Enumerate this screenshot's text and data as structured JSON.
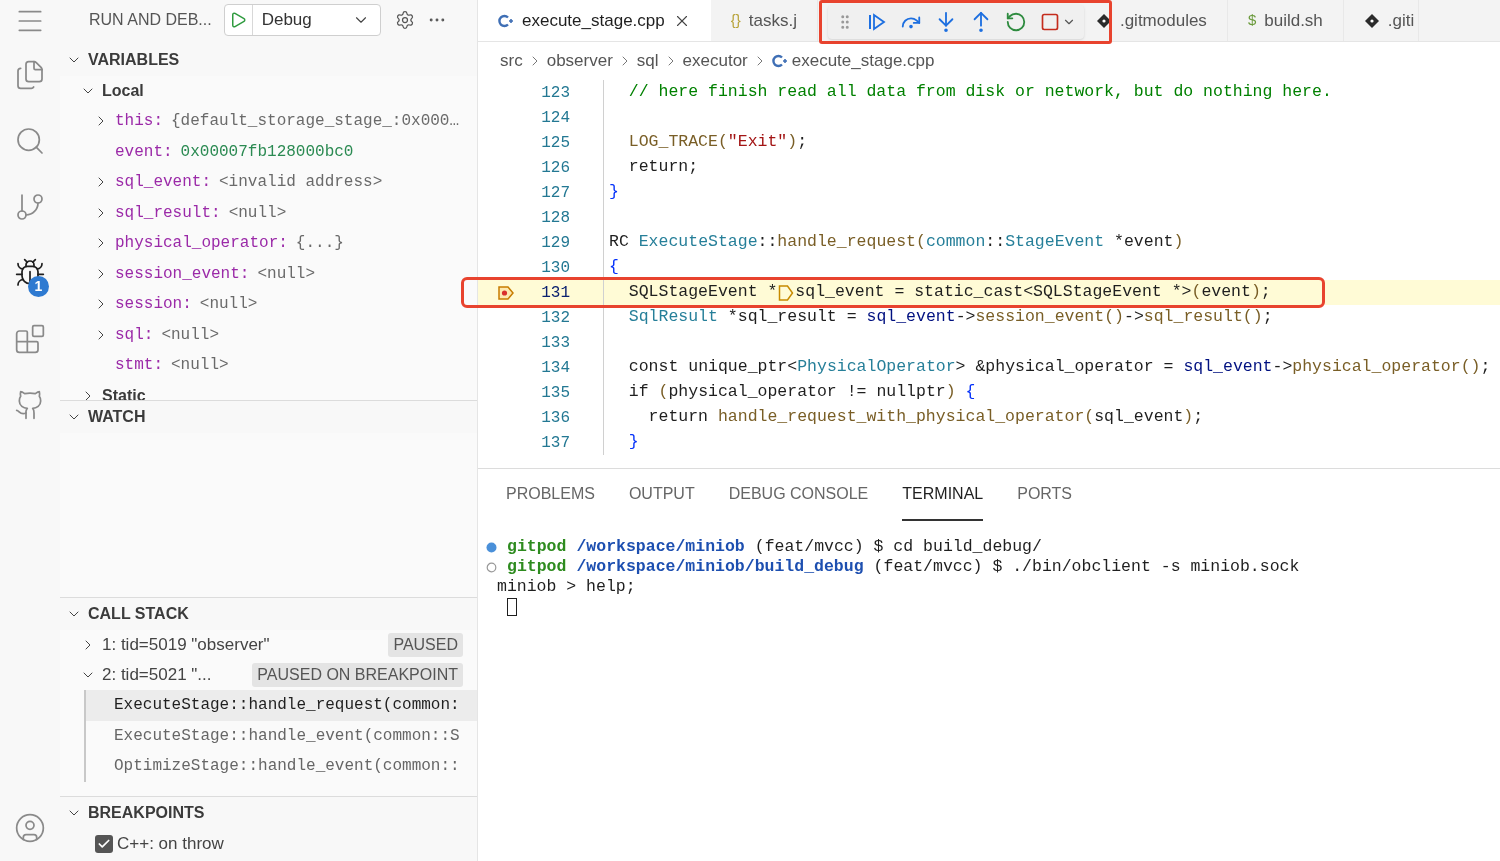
{
  "activity_bar": [
    {
      "kind": "menu",
      "selected": false
    },
    {
      "kind": "files",
      "selected": false
    },
    {
      "kind": "search",
      "selected": false
    },
    {
      "kind": "source-control",
      "selected": false
    },
    {
      "kind": "debug",
      "selected": true,
      "badge": "1"
    },
    {
      "kind": "extensions",
      "selected": false
    },
    {
      "kind": "github",
      "selected": false
    },
    {
      "kind": "account",
      "selected": false
    }
  ],
  "sidebar": {
    "title": "RUN AND DEB...",
    "config": "Debug",
    "variables": {
      "title": "VARIABLES",
      "expanded": true,
      "scopes": [
        {
          "name": "Local",
          "expanded": true,
          "children": [
            {
              "name": "this:",
              "value": "{default_storage_stage_:0x000…",
              "kind": "object",
              "expandable": true
            },
            {
              "name": "event:",
              "value": "0x00007fb128000bc0",
              "kind": "number",
              "expandable": false
            },
            {
              "name": "sql_event:",
              "value": "<invalid address>",
              "kind": "object",
              "expandable": true
            },
            {
              "name": "sql_result:",
              "value": "<null>",
              "kind": "object",
              "expandable": true
            },
            {
              "name": "physical_operator:",
              "value": "{...}",
              "kind": "object",
              "expandable": true
            },
            {
              "name": "session_event:",
              "value": "<null>",
              "kind": "object",
              "expandable": true
            },
            {
              "name": "session:",
              "value": "<null>",
              "kind": "object",
              "expandable": true
            },
            {
              "name": "sql:",
              "value": "<null>",
              "kind": "object",
              "expandable": true
            },
            {
              "name": "stmt:",
              "value": "<null>",
              "kind": "object",
              "expandable": false
            }
          ]
        },
        {
          "name": "Static",
          "expanded": false
        }
      ]
    },
    "watch": {
      "title": "WATCH",
      "expanded": true
    },
    "call_stack": {
      "title": "CALL STACK",
      "expanded": true,
      "threads": [
        {
          "name": "1: tid=5019 \"observer\"",
          "status": "PAUSED",
          "expanded": false
        },
        {
          "name": "2: tid=5021 \"...",
          "status": "PAUSED ON BREAKPOINT",
          "expanded": true,
          "frames": [
            {
              "name": "ExecuteStage::handle_request(common:",
              "selected": true
            },
            {
              "name": "ExecuteStage::handle_event(common::S",
              "selected": false
            },
            {
              "name": "OptimizeStage::handle_event(common::",
              "selected": false
            }
          ]
        }
      ]
    },
    "breakpoints": {
      "title": "BREAKPOINTS",
      "expanded": true,
      "items": [
        {
          "label": "C++: on throw",
          "checked": true
        }
      ]
    }
  },
  "editor": {
    "tabs": [
      {
        "label": "execute_stage.cpp",
        "kind": "cpp",
        "selected": true
      },
      {
        "label": "tasks.j",
        "kind": "json",
        "icon_text": "{}",
        "selected": false
      },
      {
        "label": ".gitmodules",
        "kind": "git",
        "selected": false
      },
      {
        "label": "build.sh",
        "kind": "shell",
        "icon_text": "$",
        "selected": false
      },
      {
        "label": ".giti",
        "kind": "git",
        "selected": false
      }
    ],
    "breadcrumb": [
      "src",
      "observer",
      "sql",
      "executor",
      "execute_stage.cpp"
    ],
    "lines": [
      {
        "number": "123",
        "current": false,
        "text": "  // here finish read all data from disk or network, but do nothing here."
      },
      {
        "number": "124",
        "current": false
      },
      {
        "number": "125",
        "current": false,
        "text": "  LOG_TRACE(\"Exit\");"
      },
      {
        "number": "126",
        "current": false,
        "text": "  return;"
      },
      {
        "number": "127",
        "current": false,
        "text": "}"
      },
      {
        "number": "128",
        "current": false
      },
      {
        "number": "129",
        "current": false,
        "text": "RC ExecuteStage::handle_request(common::StageEvent *event)"
      },
      {
        "number": "130",
        "current": false,
        "text": "{"
      },
      {
        "number": "131",
        "current": true,
        "text": "  SQLStageEvent *",
        "after_marker": "sql_event = static_cast<SQLStageEvent *>(event);"
      },
      {
        "number": "132",
        "current": false,
        "text": "  SqlResult *sql_result = sql_event->session_event()->sql_result();"
      },
      {
        "number": "133",
        "current": false
      },
      {
        "number": "134",
        "current": false,
        "text": "  const unique_ptr<PhysicalOperator> &physical_operator = sql_event->physical_operator();"
      },
      {
        "number": "135",
        "current": false,
        "text": "  if (physical_operator != nullptr) {"
      },
      {
        "number": "136",
        "current": false,
        "text": "    return handle_request_with_physical_operator(sql_event);"
      },
      {
        "number": "137",
        "current": false,
        "text": "  }"
      }
    ]
  },
  "panel": {
    "tabs": [
      {
        "label": "PROBLEMS",
        "selected": false
      },
      {
        "label": "OUTPUT",
        "selected": false
      },
      {
        "label": "DEBUG CONSOLE",
        "selected": false
      },
      {
        "label": "TERMINAL",
        "selected": true
      },
      {
        "label": "PORTS",
        "selected": false
      }
    ],
    "terminal": [
      {
        "kind": "filled",
        "user": "gitpod",
        "path": "/workspace/miniob",
        "rest": "(feat/mvcc) $ cd build_debug/"
      },
      {
        "kind": "hollow",
        "user": "gitpod",
        "path": "/workspace/miniob/build_debug",
        "rest": "(feat/mvcc) $ ./bin/obclient -s miniob.sock"
      },
      {
        "kind": "plain",
        "rest": "miniob > help;"
      }
    ],
    "cursor": true
  }
}
